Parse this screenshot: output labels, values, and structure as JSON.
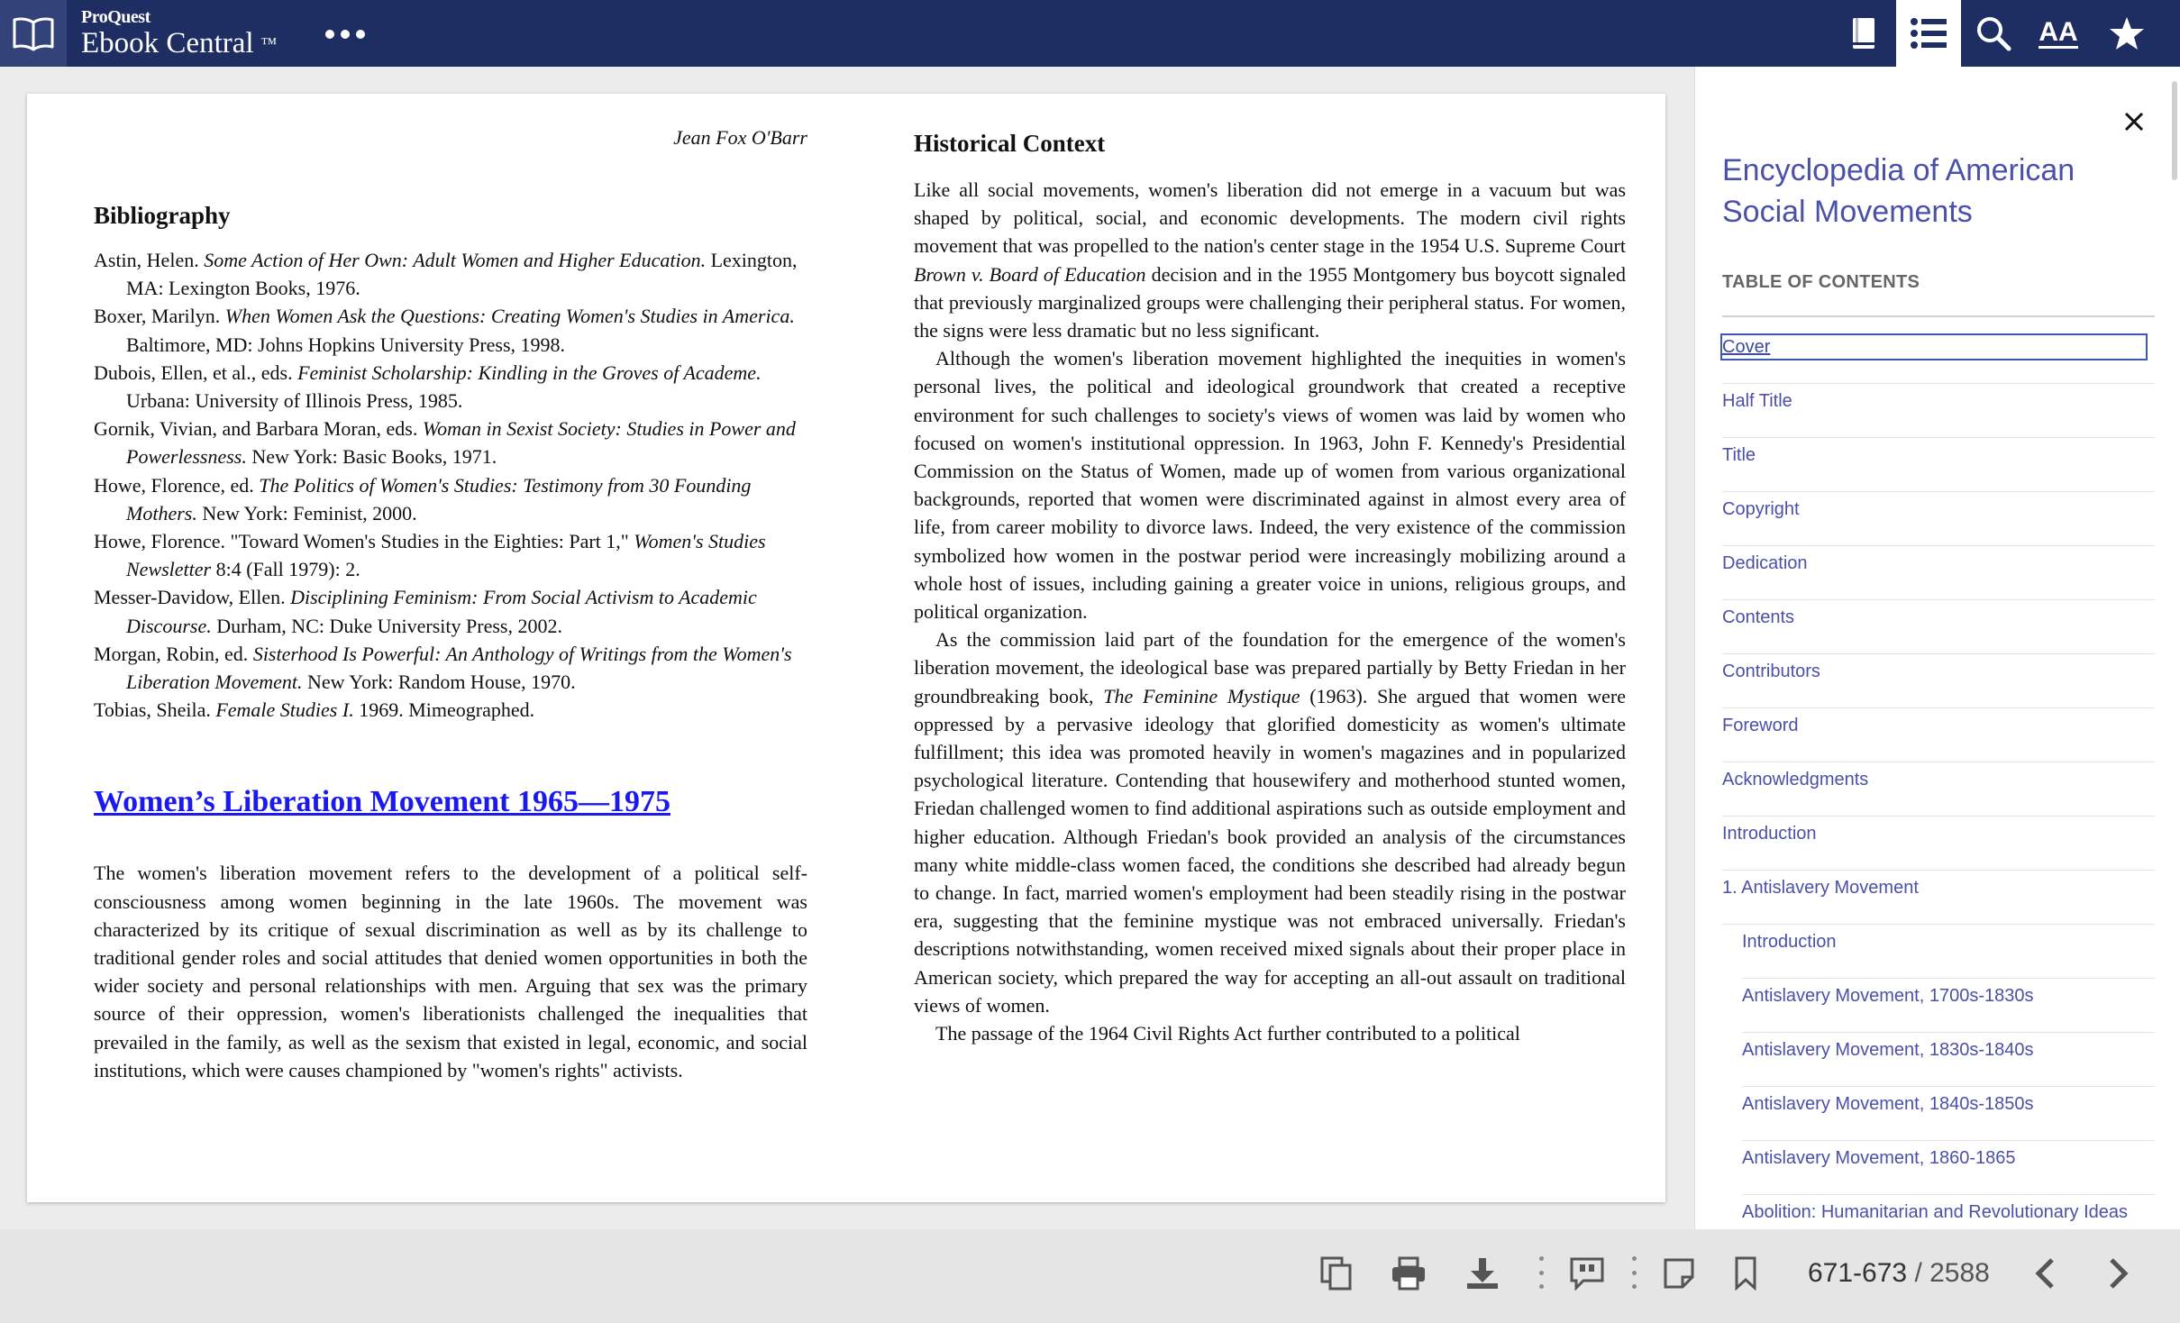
{
  "header": {
    "brand_top": "ProQuest",
    "brand_main": "Ebook Central",
    "brand_tm": "™",
    "icons": [
      "book-open-icon",
      "more-dots-icon",
      "book-icon",
      "list-icon",
      "search-icon",
      "text-size-icon",
      "star-icon"
    ],
    "text_size_glyph": "AA",
    "colors": {
      "header_bg": "#1e2d62",
      "accent": "#4b50a8",
      "link": "#1a1aee"
    }
  },
  "page": {
    "running_head": "Jean Fox O'Barr",
    "bibliography": {
      "heading": "Bibliography",
      "entries": [
        {
          "author": "Astin, Helen. ",
          "title": "Some Action of Her Own: Adult Women and Higher Education.",
          "rest": " Lexington, MA: Lexington Books, 1976."
        },
        {
          "author": "Boxer, Marilyn. ",
          "title": "When Women Ask the Questions: Creating Women's Studies in America.",
          "rest": " Baltimore, MD: Johns Hopkins University Press, 1998."
        },
        {
          "author": "Dubois, Ellen, et al., eds. ",
          "title": "Feminist Scholarship: Kindling in the Groves of Academe.",
          "rest": " Urbana: University of Illinois Press, 1985."
        },
        {
          "author": "Gornik, Vivian, and Barbara Moran, eds. ",
          "title": "Woman in Sexist Society: Studies in Power and Powerlessness.",
          "rest": " New York: Basic Books, 1971."
        },
        {
          "author": "Howe, Florence, ed. ",
          "title": "The Politics of Women's Studies: Testimony from 30 Founding Mothers.",
          "rest": " New York: Feminist, 2000."
        },
        {
          "author": "Howe, Florence. \"Toward Women's Studies in the Eighties: Part 1,\" ",
          "title": "Women's Studies Newsletter",
          "rest": " 8:4 (Fall 1979): 2."
        },
        {
          "author": "Messer-Davidow, Ellen. ",
          "title": "Disciplining Feminism: From Social Activism to Academic Discourse.",
          "rest": " Durham, NC: Duke University Press, 2002."
        },
        {
          "author": "Morgan, Robin, ed. ",
          "title": "Sisterhood Is Powerful: An Anthology of Writings from the Women's Liberation Movement.",
          "rest": " New York: Random House, 1970."
        },
        {
          "author": "Tobias, Sheila. ",
          "title": "Female Studies I.",
          "rest": " 1969. Mimeographed."
        }
      ]
    },
    "article_title": "Women’s Liberation Movement 1965—1975",
    "article_intro": "The women's liberation movement refers to the development of a political self-consciousness among women beginning in the late 1960s. The movement was characterized by its critique of sexual discrimination as well as by its challenge to traditional gender roles and social attitudes that denied women opportunities in both the wider society and personal relationships with men. Arguing that sex was the primary source of their oppression, women's liberationists challenged the inequalities that prevailed in the family, as well as the sexism that existed in legal, economic, and social institutions, which were causes championed by \"women's rights\" activists.",
    "historical_heading": "Historical Context",
    "p1_a": "Like all social movements, women's liberation did not emerge in a vacuum but was shaped by political, social, and economic developments. The modern civil rights movement that was propelled to the nation's center stage in the 1954 U.S. Supreme Court ",
    "p1_em": "Brown v. Board of Education",
    "p1_b": " decision and in the 1955 Montgomery bus boycott signaled that previously marginalized groups were challenging their peripheral status. For women, the signs were less dramatic but no less significant.",
    "p2": "Although the women's liberation movement highlighted the inequities in women's personal lives, the political and ideological groundwork that created a receptive environment for such challenges to society's views of women was laid by women who focused on women's institutional oppression. In 1963, John F. Kennedy's Presidential Commission on the Status of Women, made up of women from various organizational backgrounds, reported that women were discriminated against in almost every area of life, from career mobility to divorce laws. Indeed, the very existence of the commission symbolized how women in the postwar period were increasingly mobilizing around a whole host of issues, including gaining a greater voice in unions, religious groups, and political organization.",
    "p3_a": "As the commission laid part of the foundation for the emergence of the women's liberation movement, the ideological base was prepared partially by Betty Friedan in her groundbreaking book, ",
    "p3_em": "The Feminine Mystique",
    "p3_b": " (1963). She argued that women were oppressed by a pervasive ideology that glorified domesticity as women's ultimate fulfillment; this idea was promoted heavily in women's magazines and in popularized psychological literature. Contending that housewifery and motherhood stunted women, Friedan challenged women to find additional aspirations such as outside employment and higher education. Although Friedan's book provided an analysis of the circumstances many white middle-class women faced, the conditions she described had already begun to change. In fact, married women's employment had been steadily rising in the postwar era, suggesting that the feminine mystique was not embraced universally. Friedan's descriptions notwithstanding, women received mixed signals about their proper place in American society, which prepared the way for accepting an all-out assault on traditional views of women.",
    "p4": "The passage of the 1964 Civil Rights Act further contributed to a political"
  },
  "toc": {
    "book_title": "Encyclopedia of American Social Movements",
    "heading": "TABLE OF CONTENTS",
    "items": [
      {
        "label": "Cover",
        "level": 0,
        "current": true
      },
      {
        "label": "Half Title",
        "level": 0
      },
      {
        "label": "Title",
        "level": 0
      },
      {
        "label": "Copyright",
        "level": 0
      },
      {
        "label": "Dedication",
        "level": 0
      },
      {
        "label": "Contents",
        "level": 0
      },
      {
        "label": "Contributors",
        "level": 0
      },
      {
        "label": "Foreword",
        "level": 0
      },
      {
        "label": "Acknowledgments",
        "level": 0
      },
      {
        "label": "Introduction",
        "level": 0
      },
      {
        "label": "1. Antislavery Movement",
        "level": 0
      },
      {
        "label": "Introduction",
        "level": 1
      },
      {
        "label": "Antislavery Movement, 1700s-1830s",
        "level": 1
      },
      {
        "label": "Antislavery Movement, 1830s-1840s",
        "level": 1
      },
      {
        "label": "Antislavery Movement, 1840s-1850s",
        "level": 1
      },
      {
        "label": "Antislavery Movement, 1860-1865",
        "level": 1
      },
      {
        "label": "Abolition: Humanitarian and Revolutionary Ideas",
        "level": 1
      }
    ]
  },
  "footer": {
    "icons": [
      "copy-icon",
      "print-icon",
      "download-icon",
      "citation-icon",
      "note-icon",
      "bookmark-icon",
      "prev-page-icon",
      "next-page-icon"
    ],
    "page_range": "671-673",
    "page_sep": " / ",
    "page_total": "2588"
  }
}
